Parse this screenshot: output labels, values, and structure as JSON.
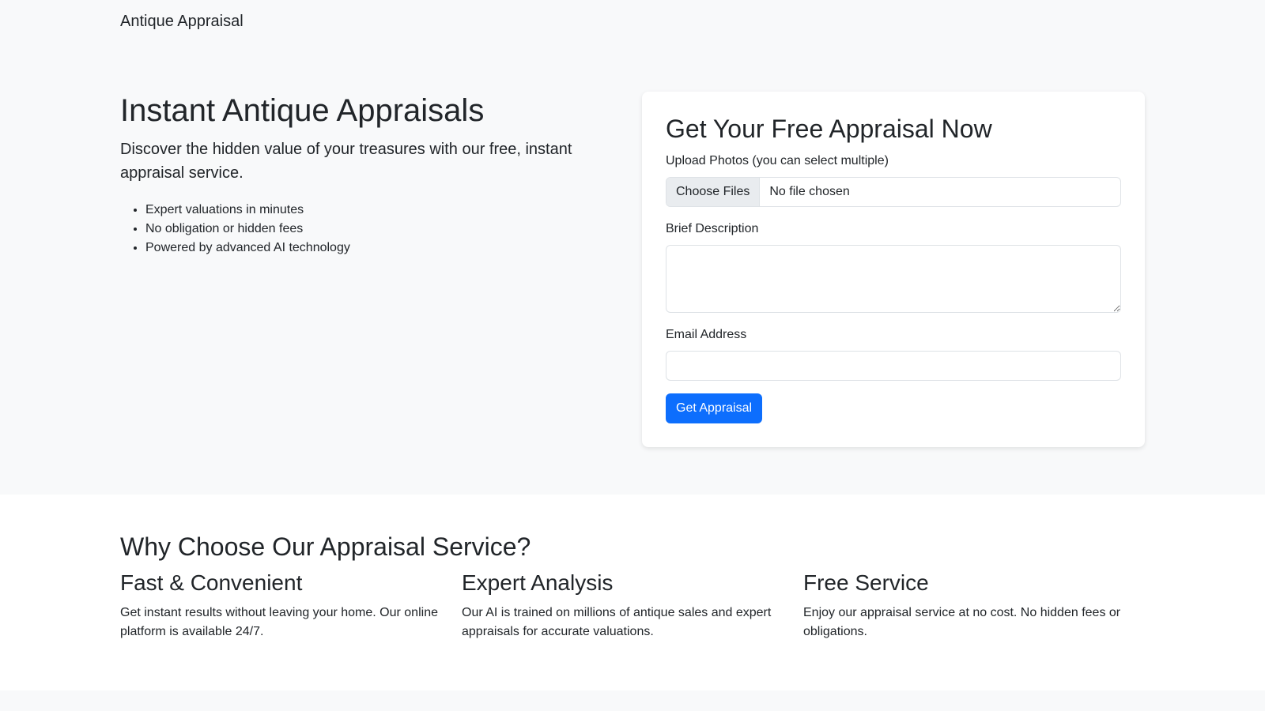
{
  "navbar": {
    "brand": "Antique Appraisal"
  },
  "hero": {
    "title": "Instant Antique Appraisals",
    "lead": "Discover the hidden value of your treasures with our free, instant appraisal service.",
    "bullets": [
      "Expert valuations in minutes",
      "No obligation or hidden fees",
      "Powered by advanced AI technology"
    ]
  },
  "form": {
    "title": "Get Your Free Appraisal Now",
    "upload_label": "Upload Photos (you can select multiple)",
    "choose_files_label": "Choose Files",
    "no_file_text": "No file chosen",
    "description_label": "Brief Description",
    "description_value": "",
    "email_label": "Email Address",
    "email_value": "",
    "submit_label": "Get Appraisal"
  },
  "features": {
    "title": "Why Choose Our Appraisal Service?",
    "items": [
      {
        "heading": "Fast & Convenient",
        "text": "Get instant results without leaving your home. Our online platform is available 24/7."
      },
      {
        "heading": "Expert Analysis",
        "text": "Our AI is trained on millions of antique sales and expert appraisals for accurate valuations."
      },
      {
        "heading": "Free Service",
        "text": "Enjoy our appraisal service at no cost. No hidden fees or obligations."
      }
    ]
  },
  "colors": {
    "primary": "#0d6efd",
    "background": "#f8f9fa",
    "text": "#212529"
  }
}
